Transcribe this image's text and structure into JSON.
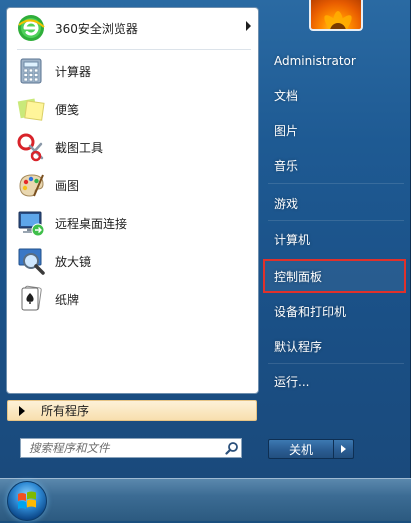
{
  "left_pane": {
    "apps": [
      {
        "label": "360安全浏览器",
        "icon": "browser-360-icon",
        "has_submenu": true
      },
      {
        "label": "计算器",
        "icon": "calculator-icon"
      },
      {
        "label": "便笺",
        "icon": "sticky-notes-icon"
      },
      {
        "label": "截图工具",
        "icon": "snipping-tool-icon"
      },
      {
        "label": "画图",
        "icon": "paint-icon"
      },
      {
        "label": "远程桌面连接",
        "icon": "remote-desktop-icon"
      },
      {
        "label": "放大镜",
        "icon": "magnifier-icon"
      },
      {
        "label": "纸牌",
        "icon": "solitaire-icon"
      }
    ],
    "all_programs": "所有程序",
    "search_placeholder": "搜索程序和文件"
  },
  "right_pane": {
    "items": [
      {
        "label": "Administrator"
      },
      {
        "label": "文档"
      },
      {
        "label": "图片"
      },
      {
        "label": "音乐"
      },
      {
        "label": "游戏"
      },
      {
        "label": "计算机"
      },
      {
        "label": "控制面板",
        "highlighted": true
      },
      {
        "label": "设备和打印机"
      },
      {
        "label": "默认程序"
      },
      {
        "label": "运行..."
      }
    ],
    "shutdown_label": "关机"
  },
  "colors": {
    "highlight_border": "#e0312b",
    "menu_bg": "#1e5a93",
    "all_programs_bg": "#f8dfae"
  }
}
